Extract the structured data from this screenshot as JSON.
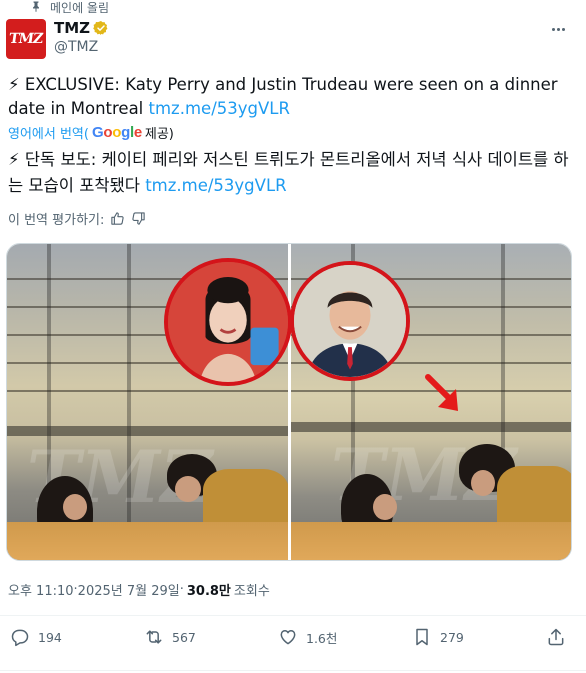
{
  "pinned": {
    "label": "메인에 올림",
    "icon": "pin-icon"
  },
  "author": {
    "name": "TMZ",
    "handle": "@TMZ",
    "avatar_text": "TMZ",
    "verified": true,
    "brand_color": "#d31d1d"
  },
  "tweet": {
    "emoji": "⚡",
    "text_en": "EXCLUSIVE: Katy Perry and Justin Trudeau were seen on a dinner date in Montreal",
    "link_en": "tmz.me/53ygVLR",
    "translated_from": "영어에서 번역(",
    "google": [
      "G",
      "o",
      "o",
      "g",
      "l",
      "e"
    ],
    "provided_by": " 제공)",
    "text_ko": "단독 보도: 케이티 페리와 저스틴 트뤼도가 몬트리올에서 저녁 식사 데이트를 하는 모습이 포착됐다",
    "link_ko": "tmz.me/53ygVLR",
    "rate_translation": "이 번역 평가하기:"
  },
  "media": {
    "watermark": "TMZ"
  },
  "meta": {
    "time": "오후 11:10",
    "separator": " · ",
    "date": "2025년 7월 29일",
    "views_count": "30.8만",
    "views_label": "조회수"
  },
  "actions": {
    "replies": "194",
    "reposts": "567",
    "likes": "1.6천",
    "bookmarks": "279"
  },
  "colors": {
    "accent": "#1d9bf0",
    "muted": "#536471",
    "verified_gold": "#e2b719"
  }
}
